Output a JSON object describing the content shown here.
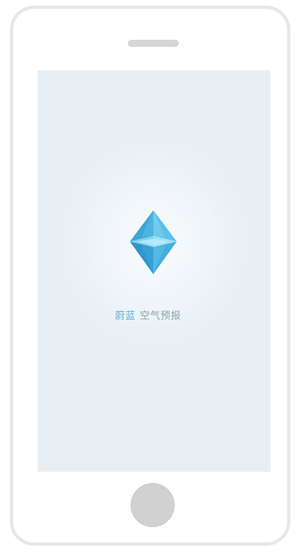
{
  "splash": {
    "app_name": "蔚蓝",
    "subtitle": "空气预报",
    "logo_icon": "blue-crystal-diamond-icon"
  },
  "colors": {
    "app_name": "#58b4d8",
    "subtitle": "#8aa3b2",
    "screen_background": "#e7eff5",
    "logo_primary": "#3aa9db"
  }
}
